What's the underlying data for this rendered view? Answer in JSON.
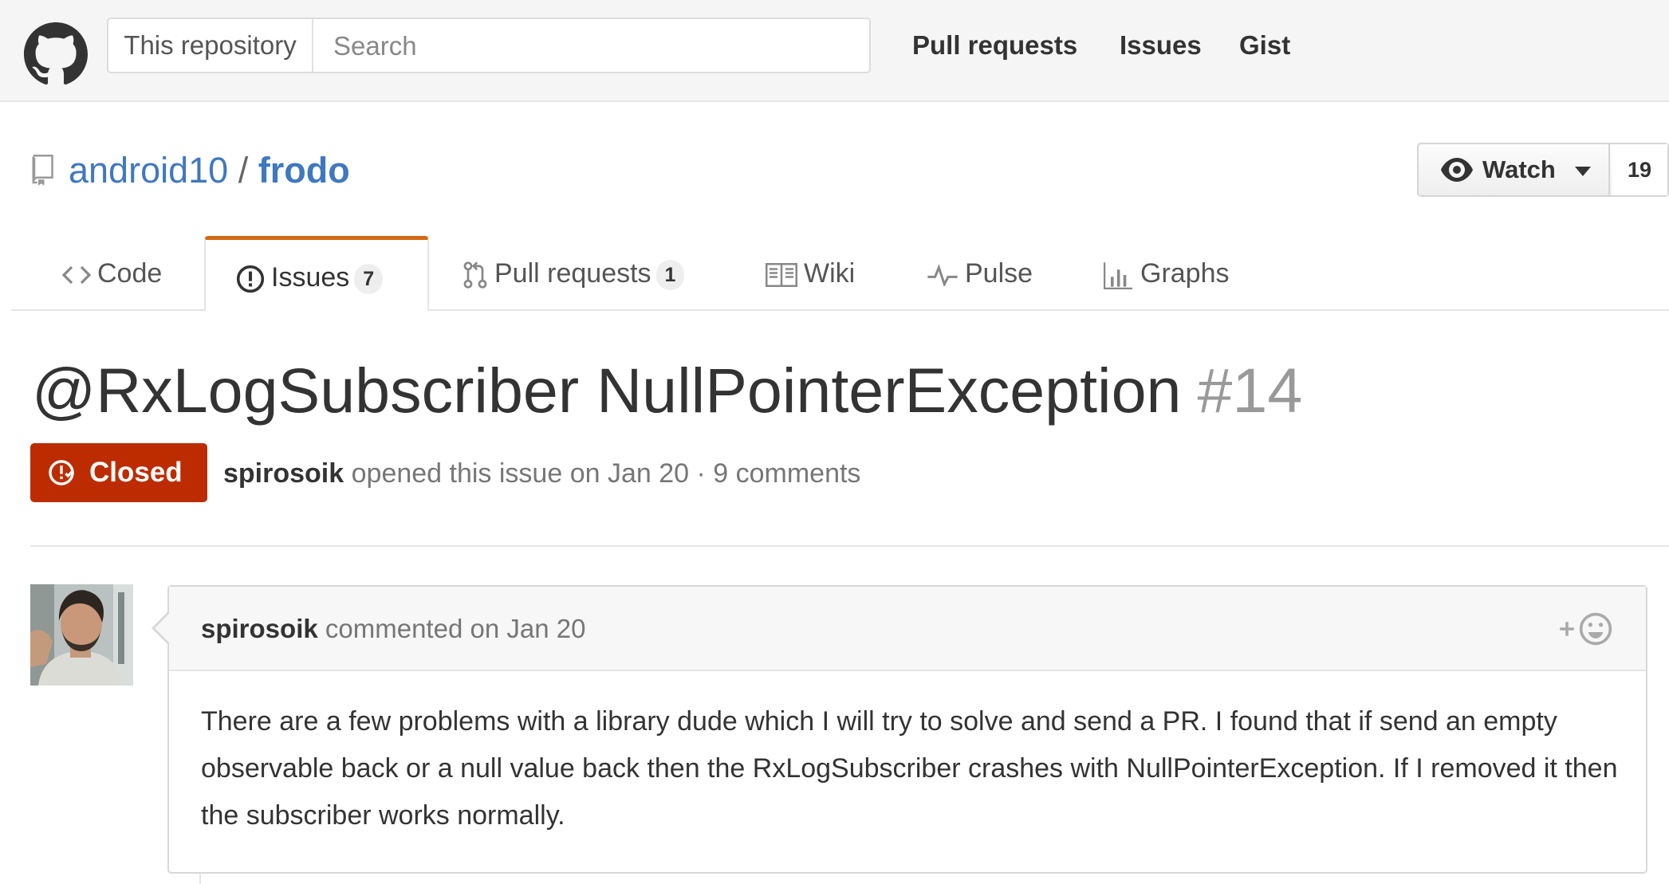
{
  "header": {
    "search_scope": "This repository",
    "search_placeholder": "Search",
    "nav": [
      "Pull requests",
      "Issues",
      "Gist"
    ]
  },
  "repo": {
    "owner": "android10",
    "separator": "/",
    "name": "frodo",
    "watch_label": "Watch",
    "watch_count": "19"
  },
  "tabs": [
    {
      "label": "Code",
      "counter": null,
      "selected": false
    },
    {
      "label": "Issues",
      "counter": "7",
      "selected": true
    },
    {
      "label": "Pull requests",
      "counter": "1",
      "selected": false
    },
    {
      "label": "Wiki",
      "counter": null,
      "selected": false
    },
    {
      "label": "Pulse",
      "counter": null,
      "selected": false
    },
    {
      "label": "Graphs",
      "counter": null,
      "selected": false
    }
  ],
  "issue": {
    "title": "@RxLogSubscriber NullPointerException",
    "number": "#14",
    "state": "Closed",
    "author": "spirosoik",
    "meta_text": "opened this issue on Jan 20 · 9 comments"
  },
  "comment": {
    "author": "spirosoik",
    "meta_text": "commented on Jan 20",
    "reaction_label": "+☺",
    "body": "There are a few problems with a library dude which I will try to solve and send a PR. I found that if send an empty observable back or a null value back then the RxLogSubscriber crashes with NullPointerException. If I removed it then the subscriber works normally."
  },
  "colors": {
    "accent_tab": "#d26911",
    "link": "#4078c0",
    "closed_badge": "#bd2c00"
  }
}
